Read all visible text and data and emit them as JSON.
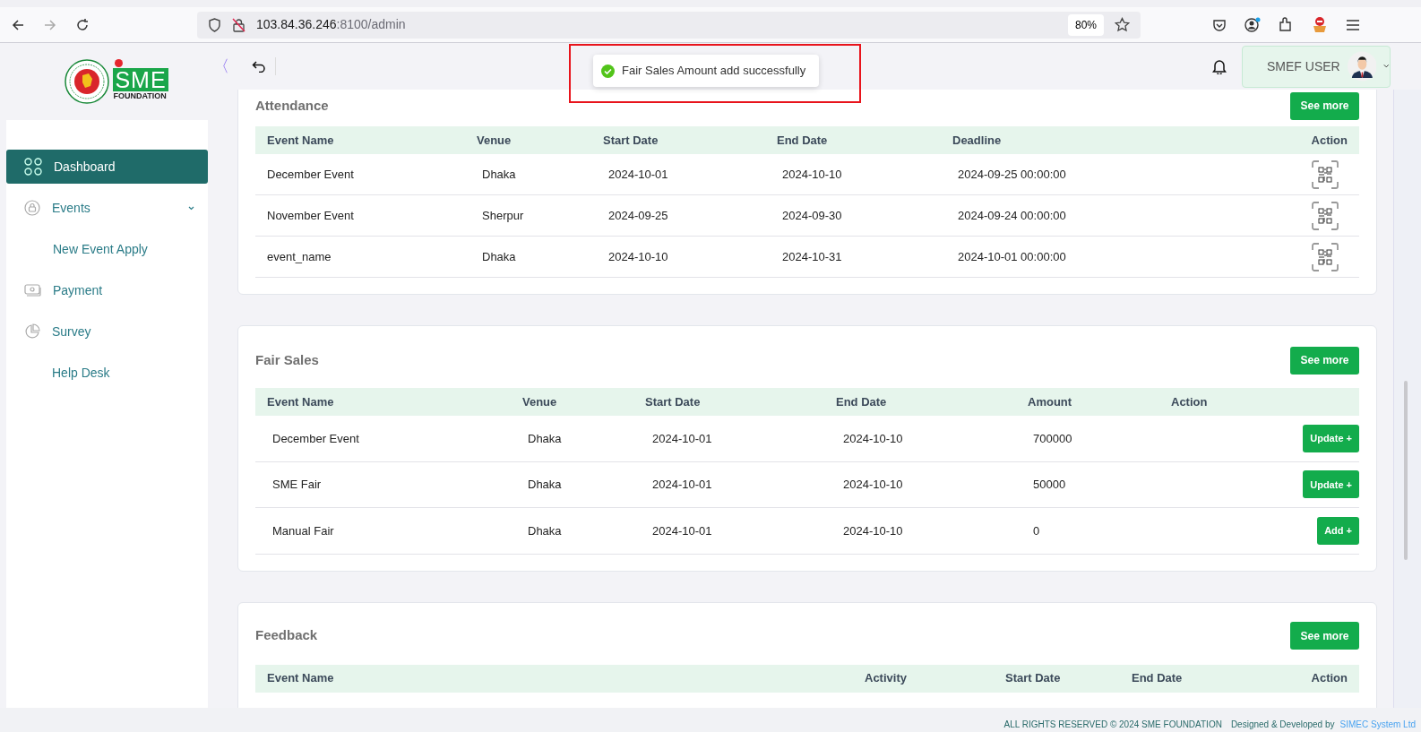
{
  "browser": {
    "url_host": "103.84.36.246",
    "url_rest": ":8100/admin",
    "zoom": "80%"
  },
  "header": {
    "collapse": "〈",
    "user": "SMEF USER",
    "logo_text": "SME",
    "logo_sub": "FOUNDATION"
  },
  "toast": {
    "message": "Fair Sales Amount add successfully"
  },
  "sidebar": {
    "items": [
      {
        "label": "Dashboard",
        "selected": true
      },
      {
        "label": "Events",
        "selected": false,
        "expanded": true
      },
      {
        "label": "New Event Apply",
        "selected": false
      },
      {
        "label": "Payment",
        "selected": false
      },
      {
        "label": "Survey",
        "selected": false
      },
      {
        "label": "Help Desk",
        "selected": false
      }
    ]
  },
  "attendance": {
    "title": "Attendance",
    "button": "See more",
    "columns": [
      "Event Name",
      "Venue",
      "Start Date",
      "End Date",
      "Deadline",
      "Action"
    ],
    "rows": [
      {
        "cells": [
          "December Event",
          "Dhaka",
          "2024-10-01",
          "2024-10-10",
          "2024-09-25 00:00:00"
        ]
      },
      {
        "cells": [
          "November Event",
          "Sherpur",
          "2024-09-25",
          "2024-09-30",
          "2024-09-24 00:00:00"
        ]
      },
      {
        "cells": [
          "event_name",
          "Dhaka",
          "2024-10-10",
          "2024-10-31",
          "2024-10-01 00:00:00"
        ]
      }
    ]
  },
  "fair_sales": {
    "title": "Fair Sales",
    "button": "See more",
    "columns": [
      "Event Name",
      "Venue",
      "Start Date",
      "End Date",
      "Amount",
      "Action"
    ],
    "rows": [
      {
        "cells": [
          "December Event",
          "Dhaka",
          "2024-10-01",
          "2024-10-10",
          "700000"
        ],
        "action": "Update +"
      },
      {
        "cells": [
          "SME Fair",
          "Dhaka",
          "2024-10-01",
          "2024-10-10",
          "50000"
        ],
        "action": "Update +"
      },
      {
        "cells": [
          "Manual Fair",
          "Dhaka",
          "2024-10-01",
          "2024-10-10",
          "0"
        ],
        "action": "Add +"
      }
    ]
  },
  "feedback": {
    "title": "Feedback",
    "button": "See more",
    "columns": [
      "Event Name",
      "Activity",
      "Start Date",
      "End Date",
      "Action"
    ]
  },
  "footer": {
    "rights": "ALL RIGHTS RESERVED © 2024 SME FOUNDATION",
    "designed": "Designed & Developed by",
    "company": "SIMEC System Ltd"
  }
}
